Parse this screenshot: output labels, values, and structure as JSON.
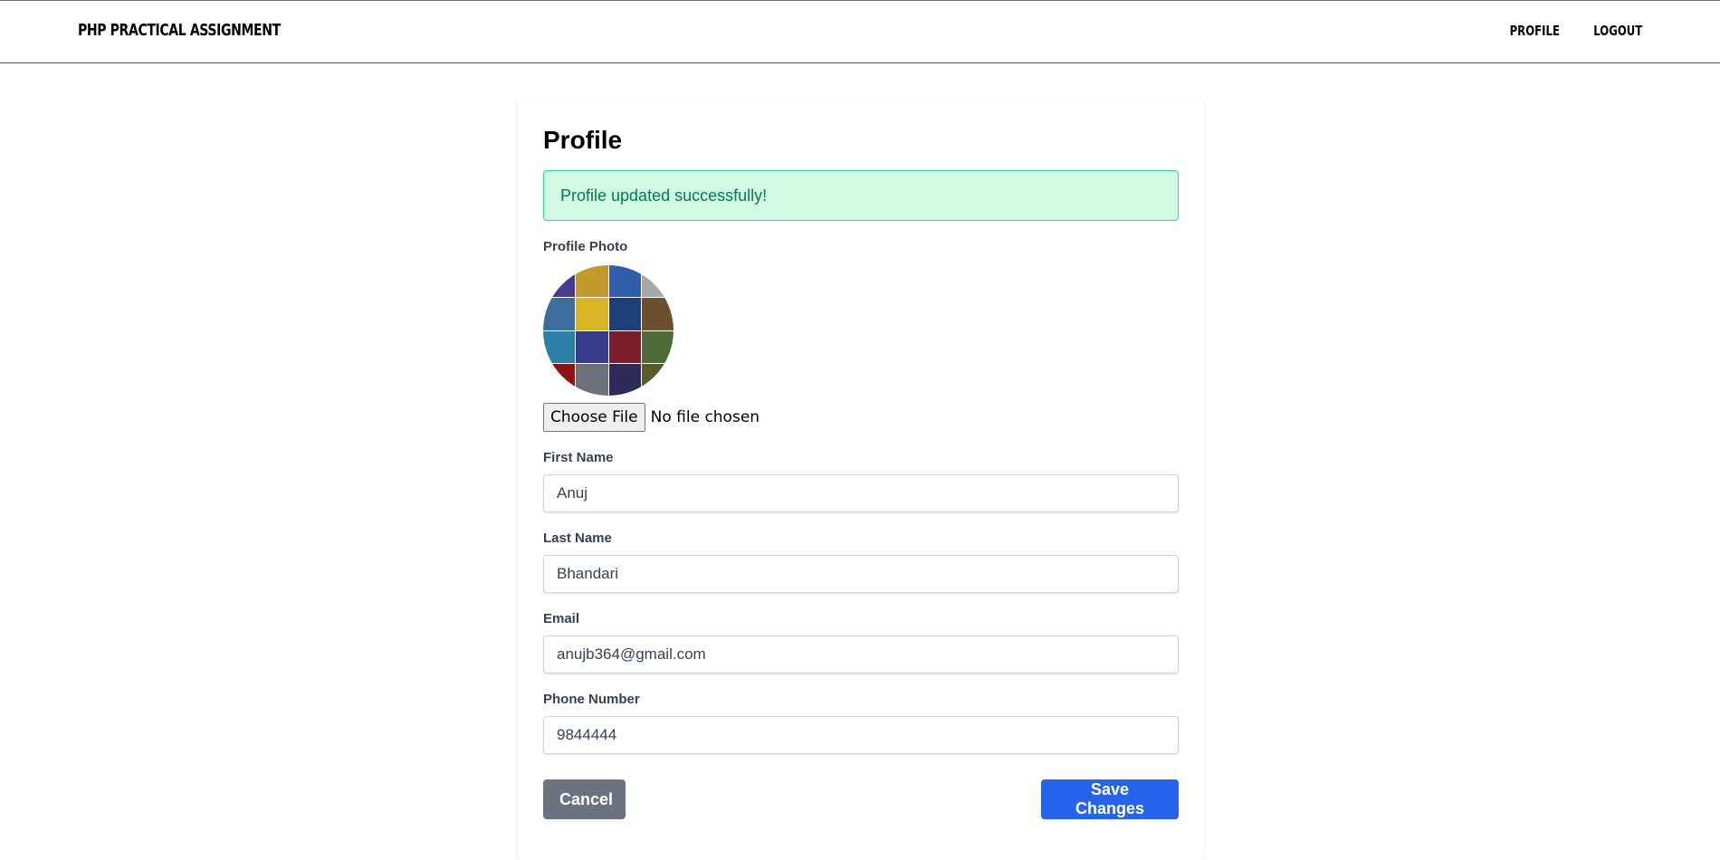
{
  "navbar": {
    "brand": "PHP PRACTICAL ASSIGNMENT",
    "links": [
      {
        "label": "PROFILE"
      },
      {
        "label": "LOGOUT"
      }
    ]
  },
  "page": {
    "title": "Profile",
    "alert": "Profile updated successfully!"
  },
  "photo": {
    "label": "Profile Photo",
    "file_button": "Choose File",
    "file_status": "No file chosen",
    "tile_colors": [
      "#4b3b8f",
      "#c59a2d",
      "#2f5fa8",
      "#a8a8a8",
      "#3b6e9c",
      "#d9b526",
      "#1f3f7a",
      "#6b4f2f",
      "#2b7fa8",
      "#3a3a8c",
      "#7a1f2a",
      "#4f6b3a",
      "#8c1414",
      "#6d7278",
      "#2e2a5a",
      "#5a5a2a"
    ]
  },
  "form": {
    "first_name": {
      "label": "First Name",
      "value": "Anuj"
    },
    "last_name": {
      "label": "Last Name",
      "value": "Bhandari"
    },
    "email": {
      "label": "Email",
      "value": "anujb364@gmail.com"
    },
    "phone": {
      "label": "Phone Number",
      "value": "9844444"
    }
  },
  "actions": {
    "cancel": "Cancel",
    "save": "Save Changes"
  },
  "colors": {
    "alert_bg": "#d1fae5",
    "alert_border": "#34d399",
    "alert_text": "#047857",
    "cancel_bg": "#6b7280",
    "save_bg": "#2563eb"
  }
}
